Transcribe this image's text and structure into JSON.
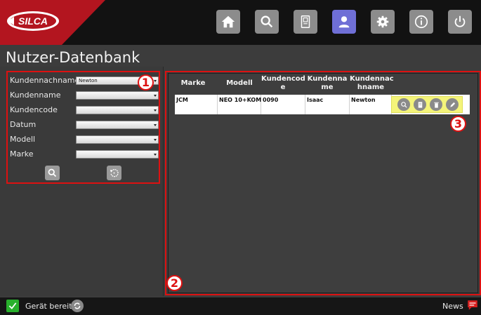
{
  "header": {
    "logo_text": "SILCA",
    "nav": [
      {
        "icon": "home-icon",
        "active": false
      },
      {
        "icon": "search-icon",
        "active": false
      },
      {
        "icon": "key-database-icon",
        "active": false
      },
      {
        "icon": "user-icon",
        "active": true
      },
      {
        "icon": "gear-icon",
        "active": false
      },
      {
        "icon": "info-icon",
        "active": false
      },
      {
        "icon": "power-icon",
        "active": false
      }
    ]
  },
  "page": {
    "title": "Nutzer-Datenbank"
  },
  "filters": {
    "fields": [
      {
        "label": "Kundennachname",
        "value": "Newton"
      },
      {
        "label": "Kundenname",
        "value": ""
      },
      {
        "label": "Kundencode",
        "value": ""
      },
      {
        "label": "Datum",
        "value": ""
      },
      {
        "label": "Modell",
        "value": ""
      },
      {
        "label": "Marke",
        "value": ""
      }
    ],
    "search_icon": "search-icon",
    "reset_icon": "reset-icon"
  },
  "table": {
    "columns": [
      "Marke",
      "Modell",
      "Kundencod\ne",
      "Kundenna\nme",
      "Kundennac\nhname"
    ],
    "rows": [
      {
        "marke": "JCM",
        "modell": "NEO 10+KOM",
        "kundencode": "0090",
        "kundenname": "Isaac",
        "kundennachname": "Newton"
      }
    ],
    "row_actions": [
      "view-icon",
      "copy-icon",
      "delete-icon",
      "edit-icon"
    ]
  },
  "callouts": [
    "1",
    "2",
    "3"
  ],
  "status": {
    "text": "Gerät bereit",
    "news": "News"
  },
  "colors": {
    "brand_red": "#b3151f",
    "active_nav": "#6f6fd6",
    "highlight": "#f4f47a",
    "ok_green": "#28b02c",
    "callout_red": "#dd1111"
  }
}
